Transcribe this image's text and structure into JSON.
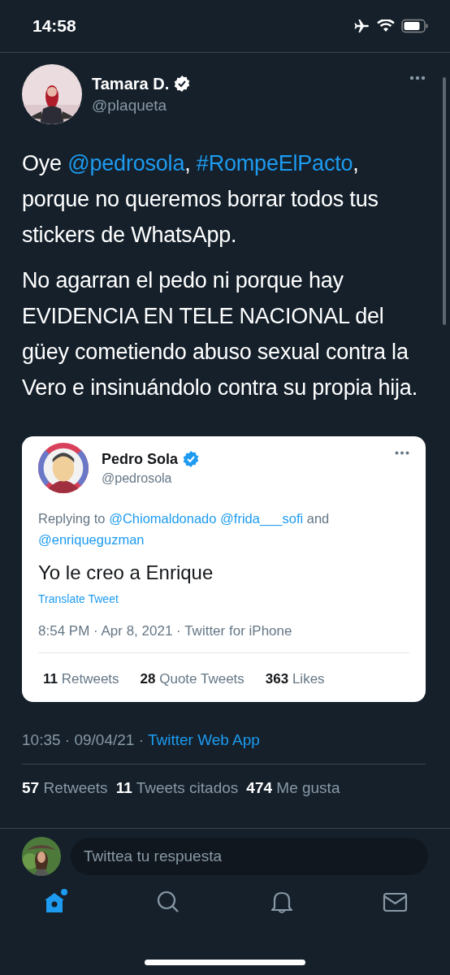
{
  "status_bar": {
    "time": "14:58"
  },
  "tweet": {
    "author": {
      "name": "Tamara D.",
      "handle": "@plaqueta",
      "verified": true
    },
    "paragraphs": [
      [
        {
          "kind": "text",
          "text": "Oye "
        },
        {
          "kind": "link",
          "text": "@pedrosola"
        },
        {
          "kind": "text",
          "text": ", "
        },
        {
          "kind": "link",
          "text": "#RompeElPacto"
        },
        {
          "kind": "text",
          "text": ", porque no queremos borrar todos tus stickers de WhatsApp."
        }
      ],
      [
        {
          "kind": "text",
          "text": "No agarran el pedo ni porque hay EVIDENCIA EN TELE NACIONAL del güey cometiendo abuso sexual contra la Vero e insinuándolo contra su propia hija."
        }
      ]
    ],
    "quoted": {
      "author": {
        "name": "Pedro Sola",
        "handle": "@pedrosola",
        "verified": true
      },
      "reply_prefix": "Replying to ",
      "reply_to": [
        "@Chiomaldonado",
        "@frida___sofi"
      ],
      "reply_join": "and",
      "reply_last": "@enriqueguzman",
      "text": "Yo le creo a Enrique",
      "translate": "Translate Tweet",
      "meta": "8:54 PM · Apr 8, 2021 · Twitter for iPhone",
      "stats": [
        {
          "count": "11",
          "label": "Retweets"
        },
        {
          "count": "28",
          "label": "Quote Tweets"
        },
        {
          "count": "363",
          "label": "Likes"
        }
      ]
    },
    "timestamp": "10:35 · 09/04/21 · ",
    "source": "Twitter Web App",
    "stats": [
      {
        "count": "57",
        "label": "Retweets"
      },
      {
        "count": "11",
        "label": "Tweets citados"
      },
      {
        "count": "474",
        "label": "Me gusta"
      }
    ]
  },
  "reply": {
    "placeholder": "Twittea tu respuesta"
  },
  "tab_bar": [
    {
      "kind": "home",
      "selected": true,
      "badge": true
    },
    {
      "kind": "search",
      "selected": false,
      "badge": false
    },
    {
      "kind": "bell",
      "selected": false,
      "badge": false
    },
    {
      "kind": "mail",
      "selected": false,
      "badge": false
    }
  ]
}
